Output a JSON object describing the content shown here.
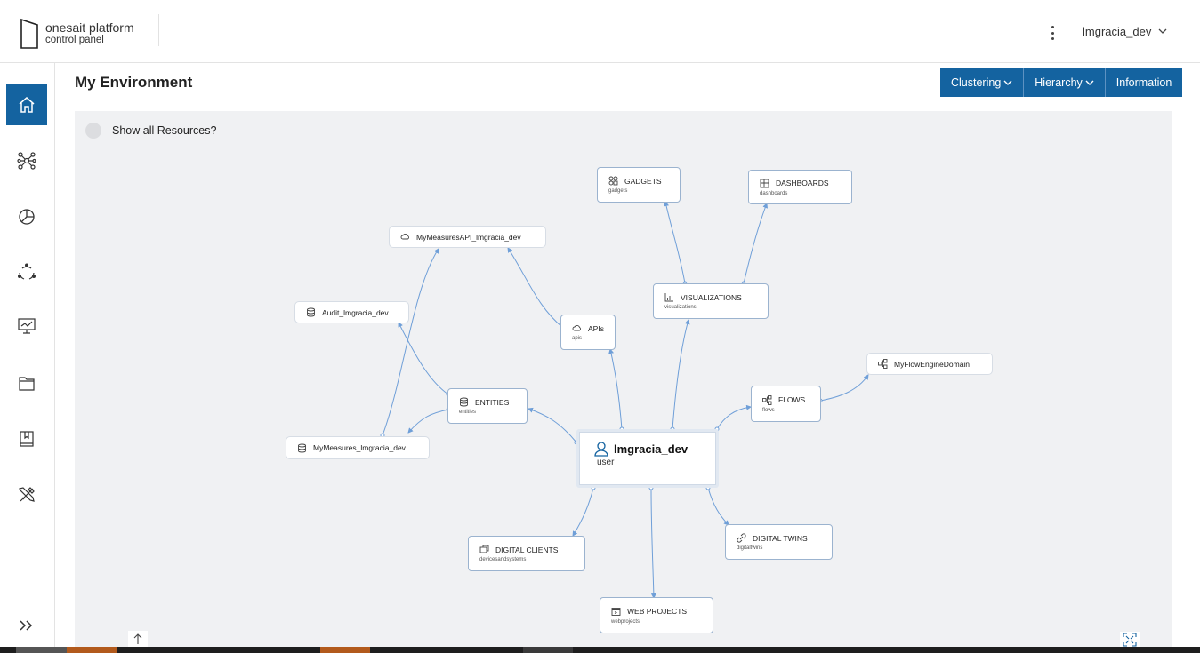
{
  "header": {
    "brand_title": "onesait platform",
    "brand_subtitle": "control panel",
    "user_name": "lmgracia_dev"
  },
  "sidebar": {
    "items": [
      {
        "icon": "home-icon",
        "active": true
      },
      {
        "icon": "network-icon",
        "active": false
      },
      {
        "icon": "pie-chart-icon",
        "active": false
      },
      {
        "icon": "share-cycle-icon",
        "active": false
      },
      {
        "icon": "monitor-chart-icon",
        "active": false
      },
      {
        "icon": "folders-icon",
        "active": false
      },
      {
        "icon": "book-icon",
        "active": false
      },
      {
        "icon": "tools-icon",
        "active": false
      }
    ],
    "expand_icon": "double-chevron-right-icon"
  },
  "main": {
    "title": "My Environment",
    "buttons": {
      "clustering": "Clustering",
      "hierarchy": "Hierarchy",
      "information": "Information"
    },
    "show_all_label": "Show all Resources?"
  },
  "graph": {
    "center": {
      "name": "lmgracia_dev",
      "type": "user"
    },
    "nodes": {
      "gadgets": {
        "label": "GADGETS",
        "sub": "gadgets"
      },
      "dashboards": {
        "label": "DASHBOARDS",
        "sub": "dashboards"
      },
      "api_instance": {
        "label": "MyMeasuresAPI_lmgracia_dev"
      },
      "visualizations": {
        "label": "VISUALIZATIONS",
        "sub": "visualizations"
      },
      "audit_entity": {
        "label": "Audit_lmgracia_dev"
      },
      "apis": {
        "label": "APIs",
        "sub": "apis"
      },
      "flow_domain": {
        "label": "MyFlowEngineDomain"
      },
      "entities": {
        "label": "ENTITIES",
        "sub": "entities"
      },
      "flows": {
        "label": "FLOWS",
        "sub": "flows"
      },
      "measures_entity": {
        "label": "MyMeasures_lmgracia_dev"
      },
      "digital_clients": {
        "label": "DIGITAL CLIENTS",
        "sub": "devicesandsystems"
      },
      "digital_twins": {
        "label": "DIGITAL TWINS",
        "sub": "digitaltwins"
      },
      "web_projects": {
        "label": "WEB PROJECTS",
        "sub": "webprojects"
      }
    }
  },
  "colors": {
    "accent": "#1463a0",
    "edge": "#6f9fd8",
    "canvas": "#f0f1f3"
  }
}
